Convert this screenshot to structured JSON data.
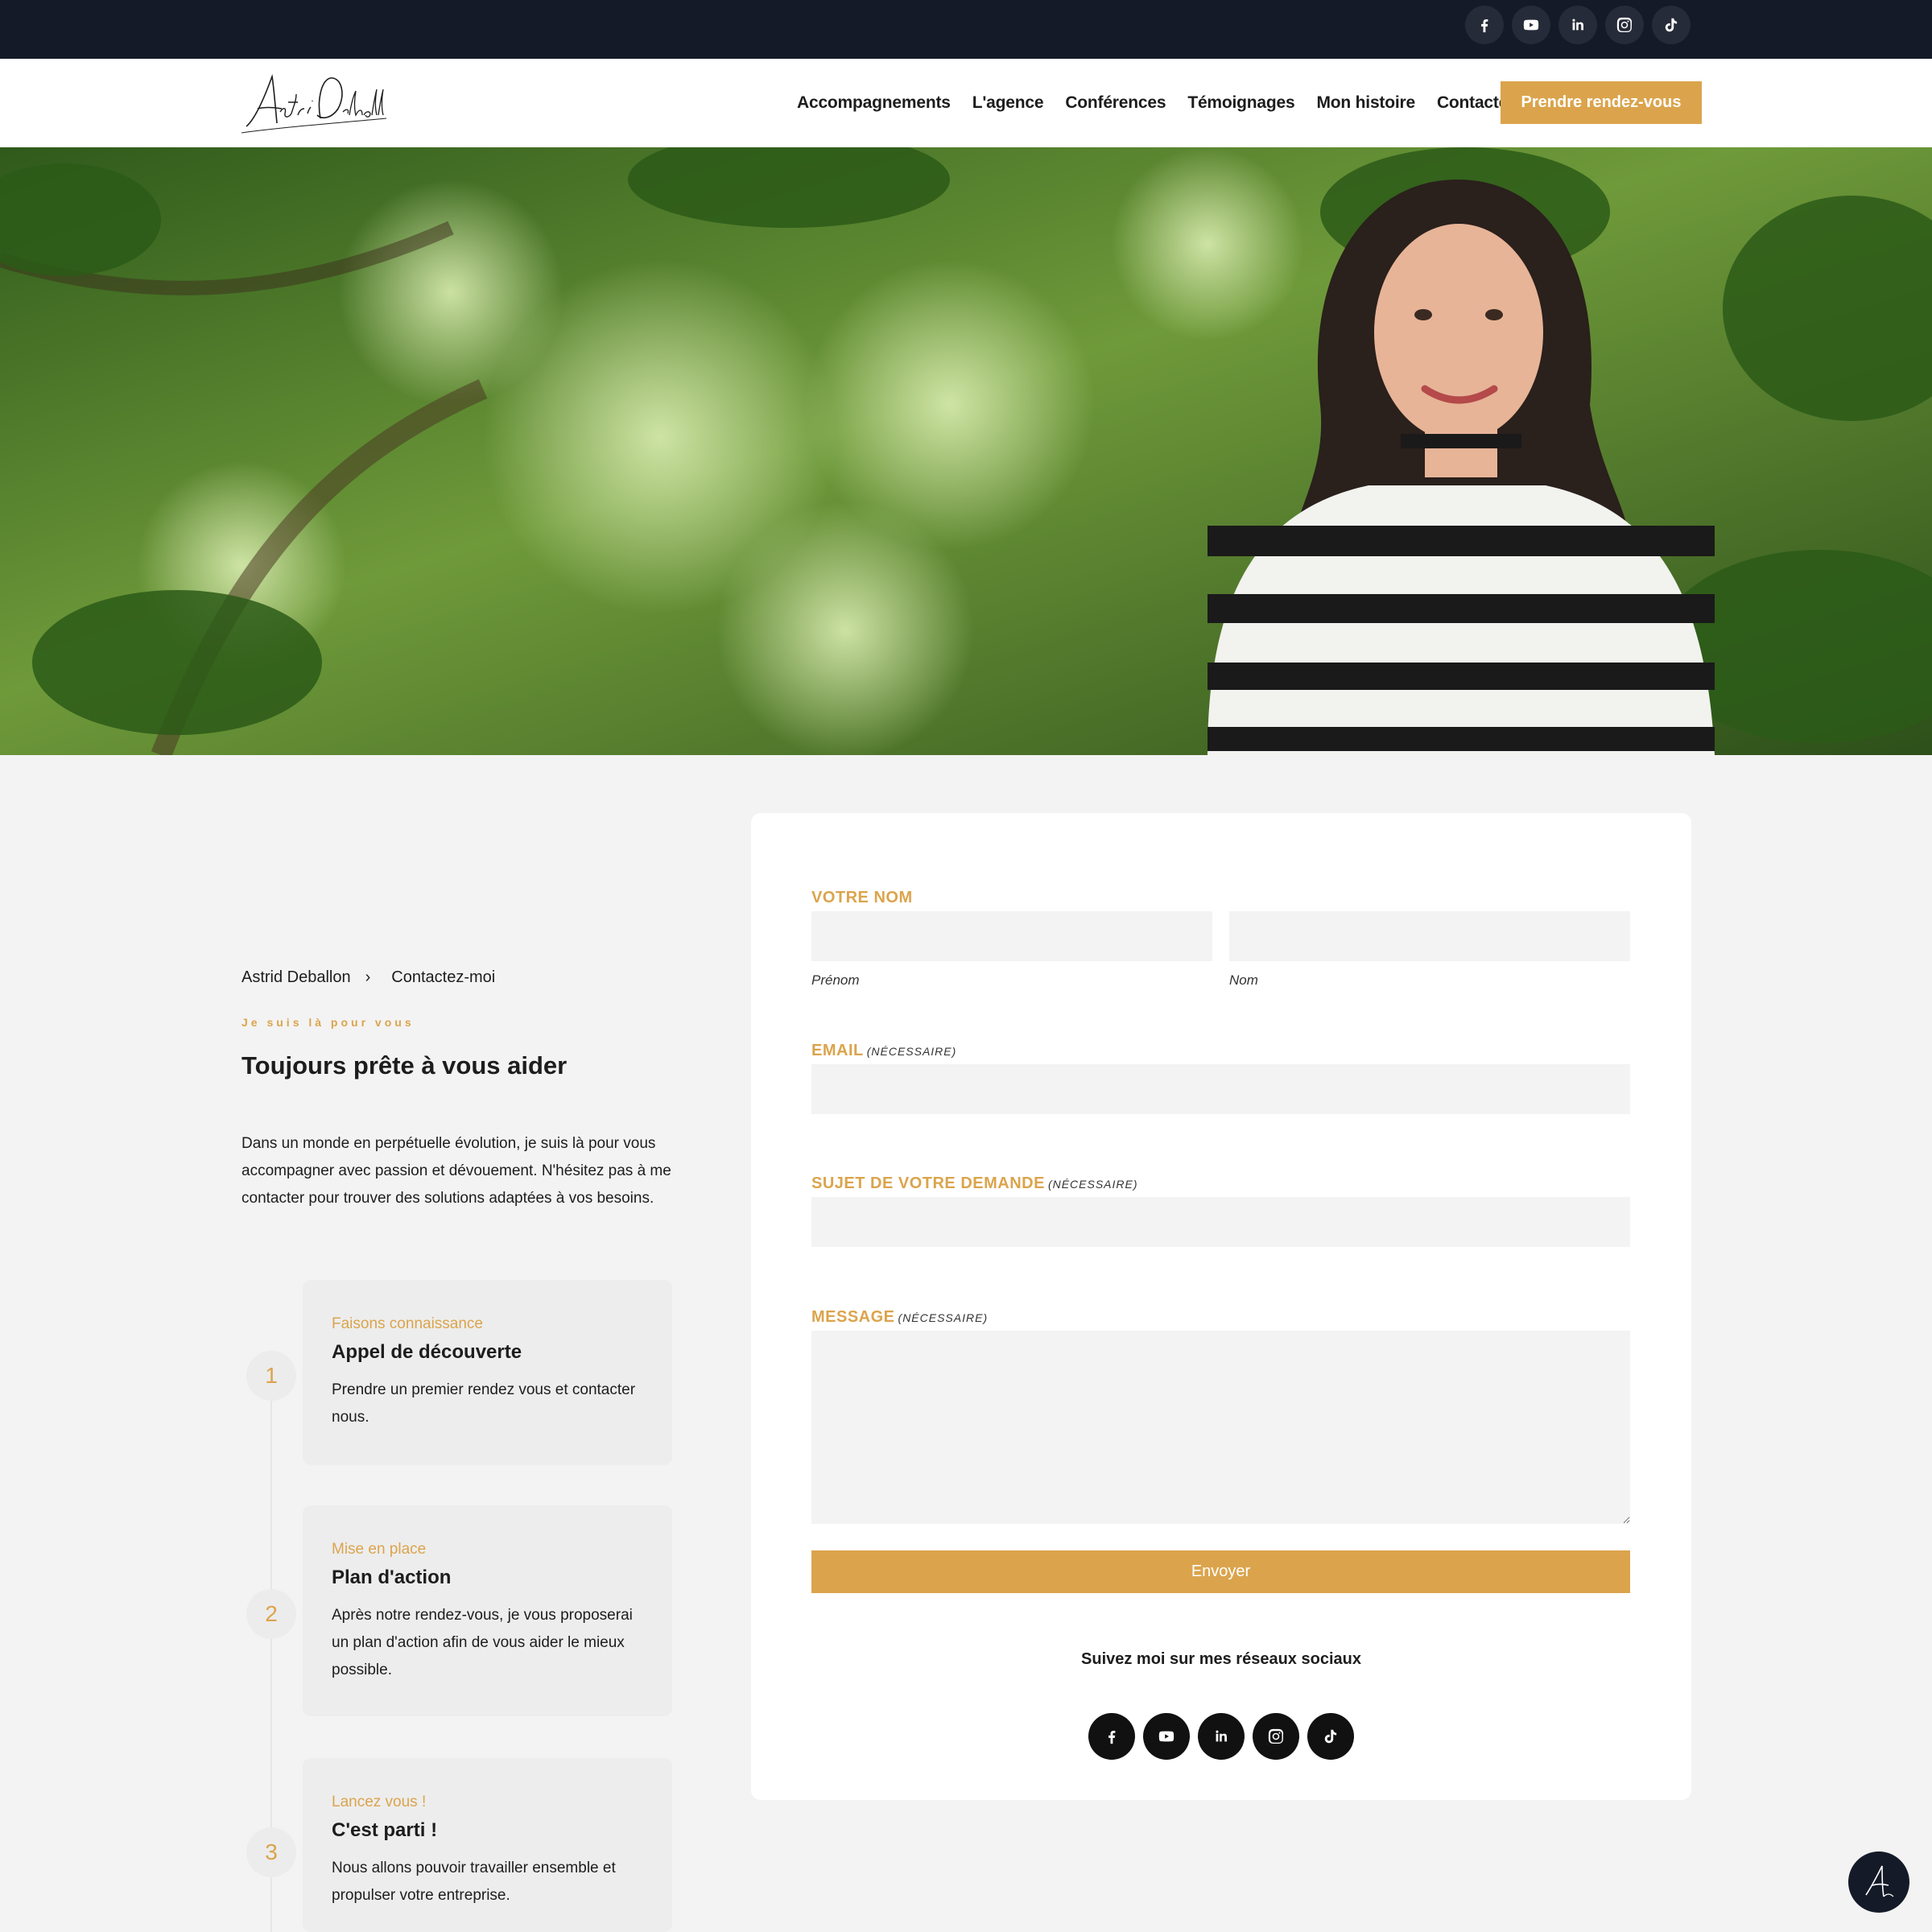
{
  "topbar": {
    "socials": [
      {
        "icon": "facebook-icon",
        "name": "Facebook"
      },
      {
        "icon": "youtube-icon",
        "name": "YouTube"
      },
      {
        "icon": "linkedin-icon",
        "name": "LinkedIn"
      },
      {
        "icon": "instagram-icon",
        "name": "Instagram"
      },
      {
        "icon": "tiktok-icon",
        "name": "TikTok"
      }
    ]
  },
  "header": {
    "logo_text": "Astrid Deballon",
    "nav": [
      "Accompagnements",
      "L'agence",
      "Conférences",
      "Témoignages",
      "Mon histoire",
      "Contactez-moi"
    ],
    "cta": "Prendre rendez-vous"
  },
  "breadcrumb": {
    "home": "Astrid Deballon",
    "separator": "›",
    "current": "Contactez-moi"
  },
  "intro": {
    "eyebrow": "Je suis là pour vous",
    "title": "Toujours prête à vous aider",
    "text": "Dans un monde en perpétuelle évolution, je suis là pour vous accompagner avec passion et dévouement. N'hésitez pas à me contacter pour trouver des solutions adaptées à vos besoins."
  },
  "steps": [
    {
      "num": "1",
      "kicker": "Faisons connaissance",
      "title": "Appel de découverte",
      "desc": "Prendre un premier rendez vous et contacter nous."
    },
    {
      "num": "2",
      "kicker": "Mise en place",
      "title": "Plan d'action",
      "desc": "Après notre rendez-vous, je vous proposerai un plan d'action afin de vous aider le mieux possible."
    },
    {
      "num": "3",
      "kicker": "Lancez vous !",
      "title": "C'est parti !",
      "desc": "Nous allons pouvoir travailler ensemble et propulser votre entreprise."
    }
  ],
  "form": {
    "name_label": "VOTRE NOM",
    "firstname_sublabel": "Prénom",
    "lastname_sublabel": "Nom",
    "email_label": "EMAIL",
    "subject_label": "SUJET DE VOTRE DEMANDE",
    "message_label": "MESSAGE",
    "required": "(NÉCESSAIRE)",
    "submit": "Envoyer",
    "follow": "Suivez moi sur mes réseaux sociaux"
  },
  "colors": {
    "accent": "#dba44c",
    "dark": "#151a28",
    "background": "#f3f3f3"
  }
}
